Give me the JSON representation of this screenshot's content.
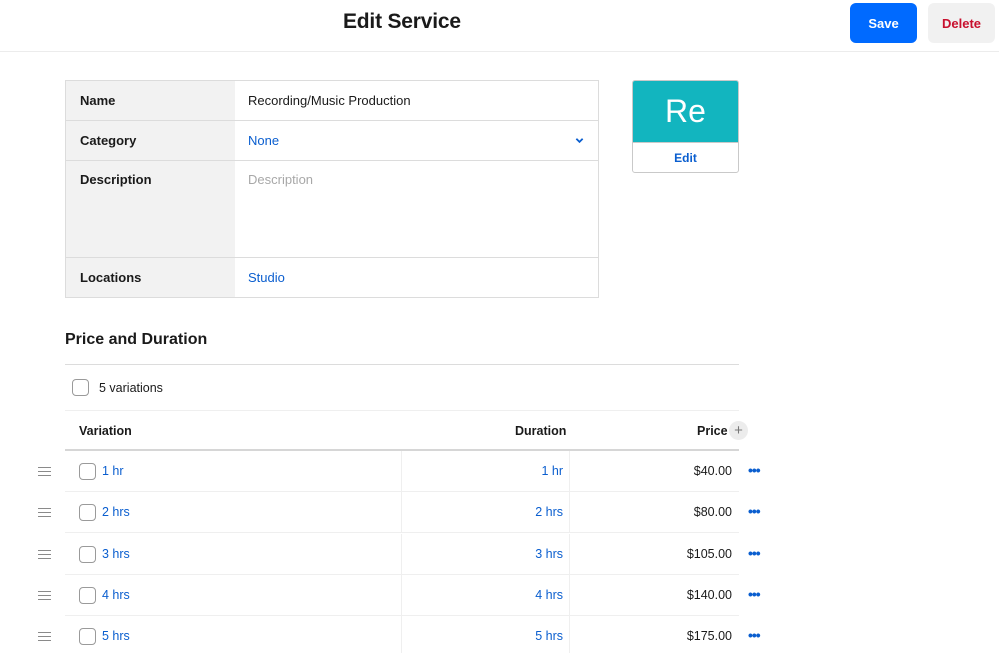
{
  "header": {
    "title": "Edit Service",
    "save_label": "Save",
    "delete_label": "Delete"
  },
  "form": {
    "name": {
      "label": "Name",
      "value": "Recording/Music Production"
    },
    "category": {
      "label": "Category",
      "value": "None",
      "icon": "chevron-down-icon"
    },
    "description": {
      "label": "Description",
      "value": "",
      "placeholder": "Description"
    },
    "locations": {
      "label": "Locations",
      "value": "Studio"
    }
  },
  "image_tile": {
    "initials": "Re",
    "edit_label": "Edit",
    "color": "#12b5bf"
  },
  "price_duration": {
    "title": "Price and Duration",
    "select_all_label": "5 variations",
    "columns": {
      "variation": "Variation",
      "duration": "Duration",
      "price": "Price"
    },
    "add_icon": "plus-icon",
    "rows": [
      {
        "name": "1 hr",
        "duration": "1 hr",
        "price": "$40.00"
      },
      {
        "name": "2 hrs",
        "duration": "2 hrs",
        "price": "$80.00"
      },
      {
        "name": "3 hrs",
        "duration": "3 hrs",
        "price": "$105.00"
      },
      {
        "name": "4 hrs",
        "duration": "4 hrs",
        "price": "$140.00"
      },
      {
        "name": "5 hrs",
        "duration": "5 hrs",
        "price": "$175.00"
      }
    ]
  },
  "colors": {
    "primary": "#006aff",
    "danger": "#c8102e",
    "link": "#0a5ecf"
  }
}
